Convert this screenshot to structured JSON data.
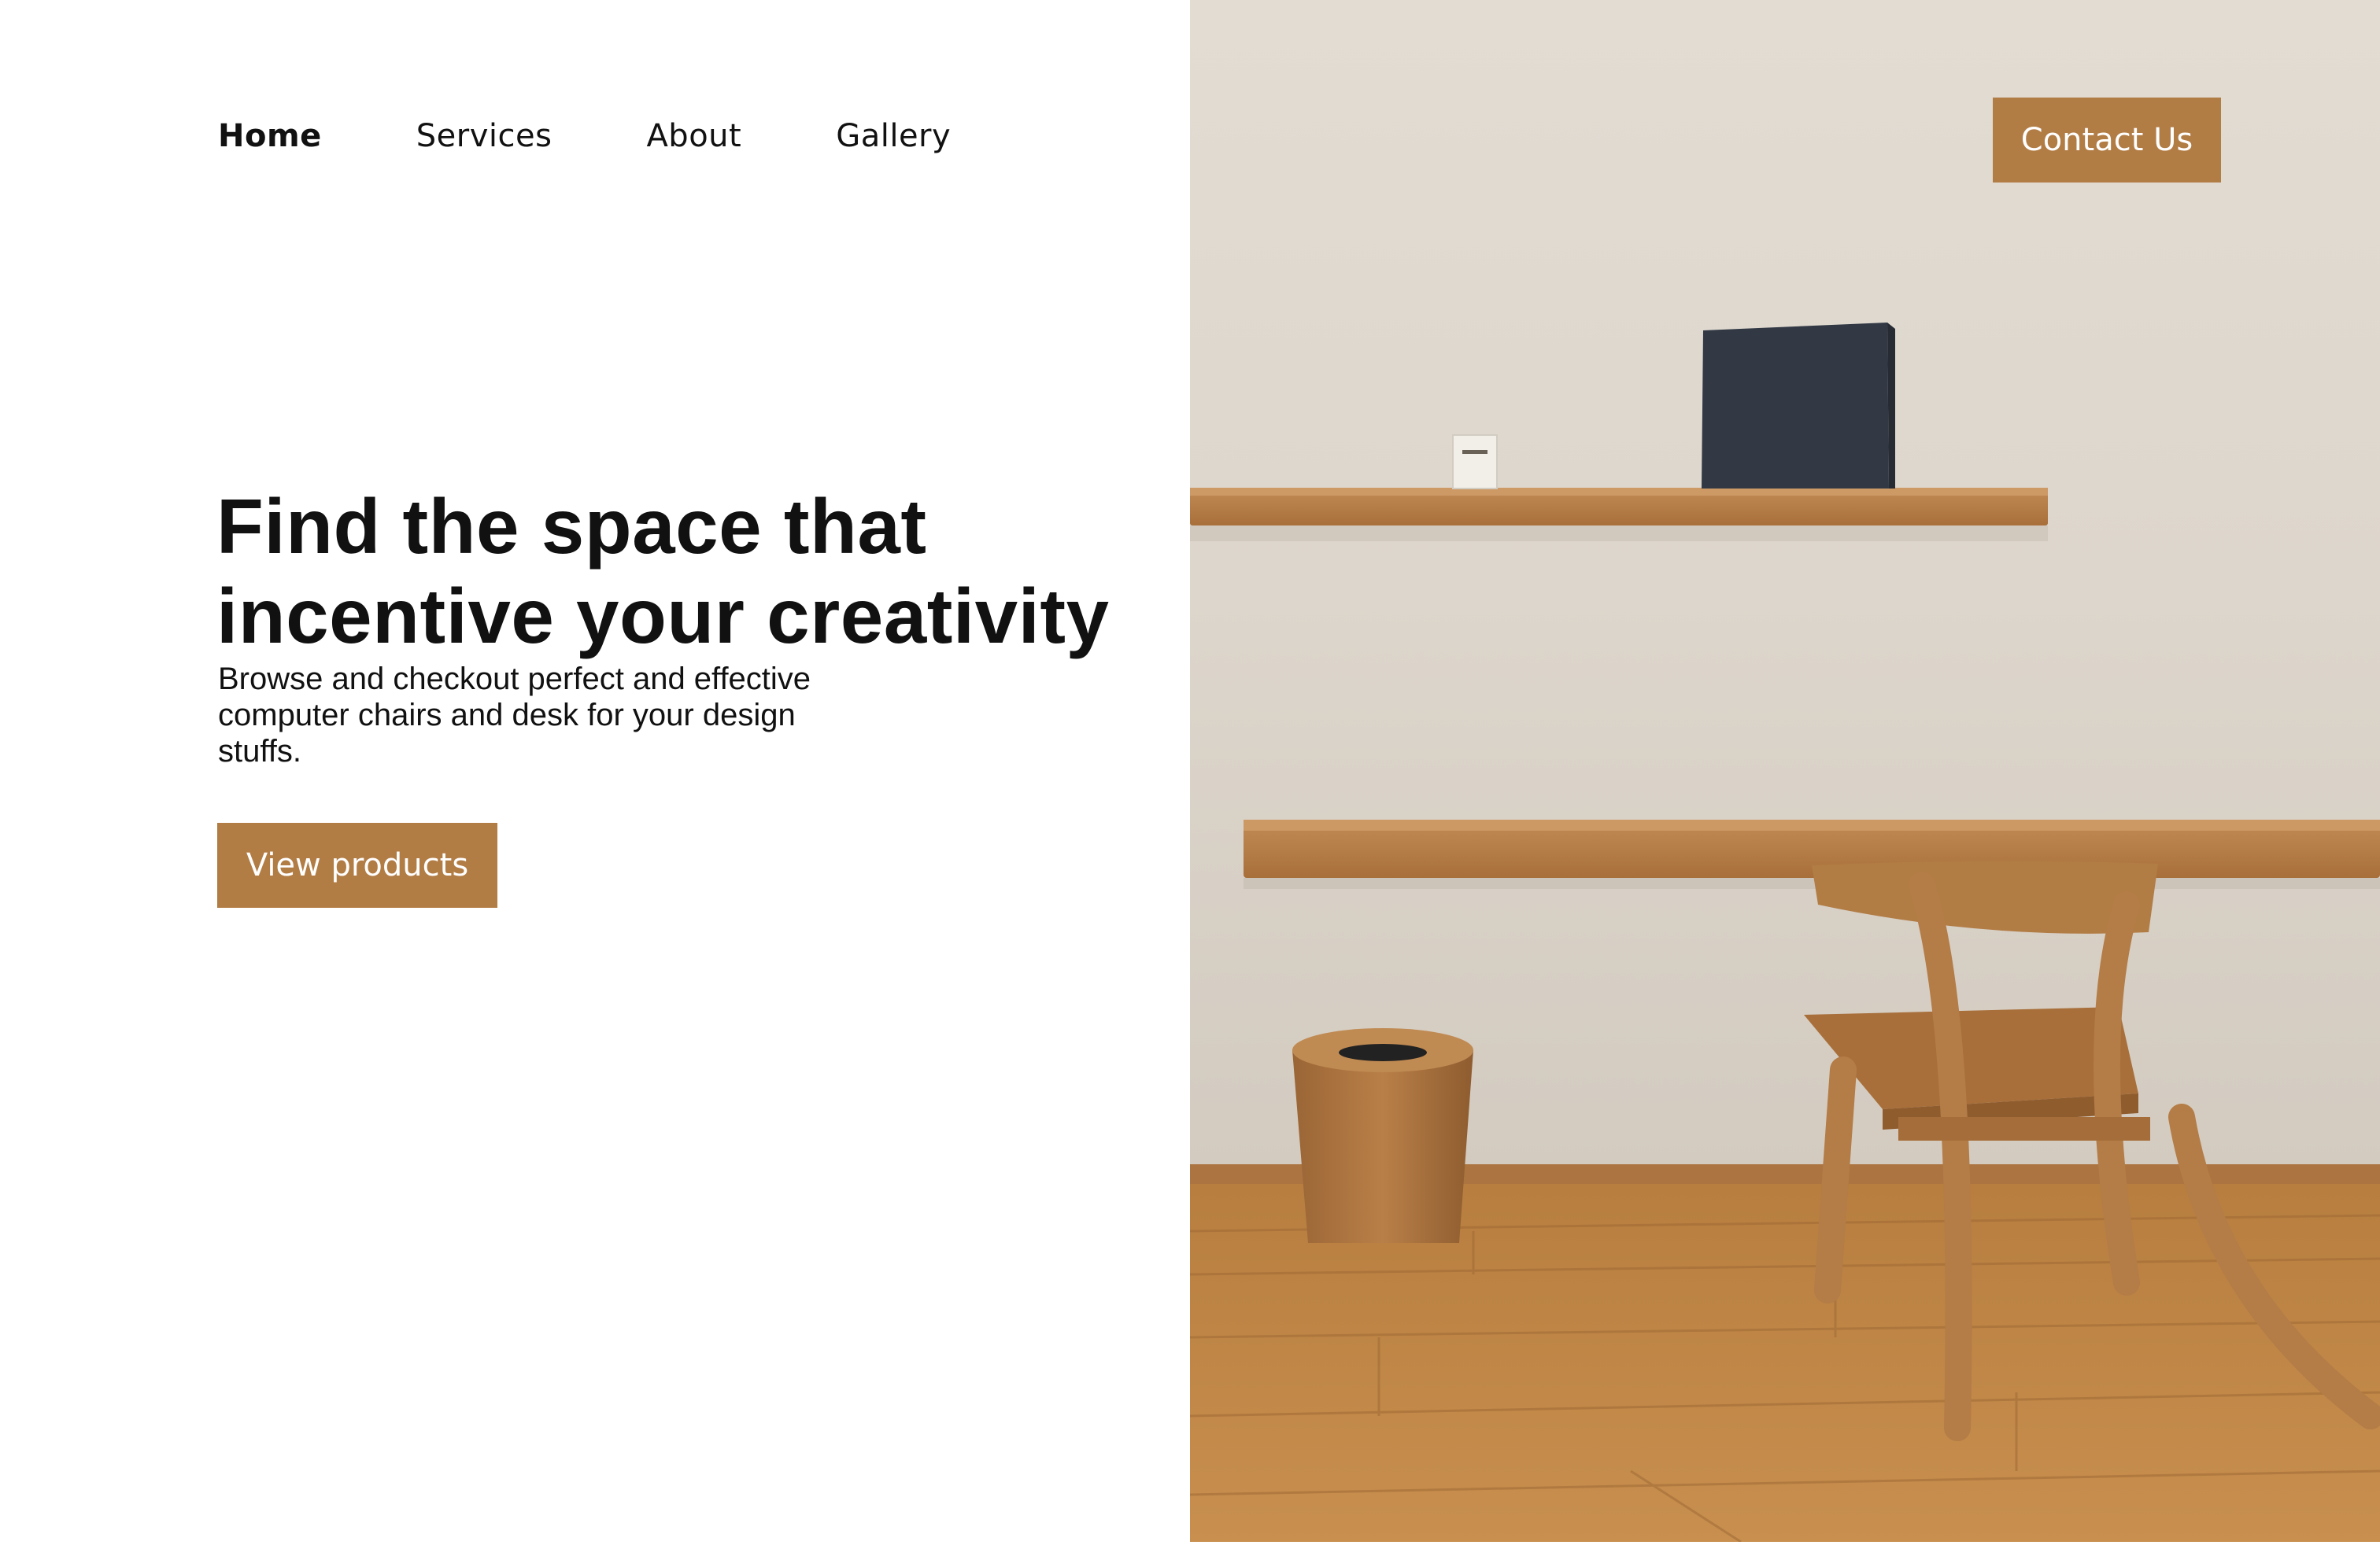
{
  "nav": {
    "items": [
      {
        "label": "Home",
        "active": true
      },
      {
        "label": "Services",
        "active": false
      },
      {
        "label": "About",
        "active": false
      },
      {
        "label": "Gallery",
        "active": false
      }
    ]
  },
  "header": {
    "contact_label": "Contact Us"
  },
  "hero": {
    "title_line1": "Find the space that",
    "title_line2": "incentive your creativity",
    "subtitle": "Browse and checkout perfect and effective\ncomputer chairs and  desk for  your design\nstuffs.",
    "cta_label": "View products"
  },
  "colors": {
    "accent": "#b27c45",
    "text": "#111111",
    "background": "#ffffff"
  }
}
